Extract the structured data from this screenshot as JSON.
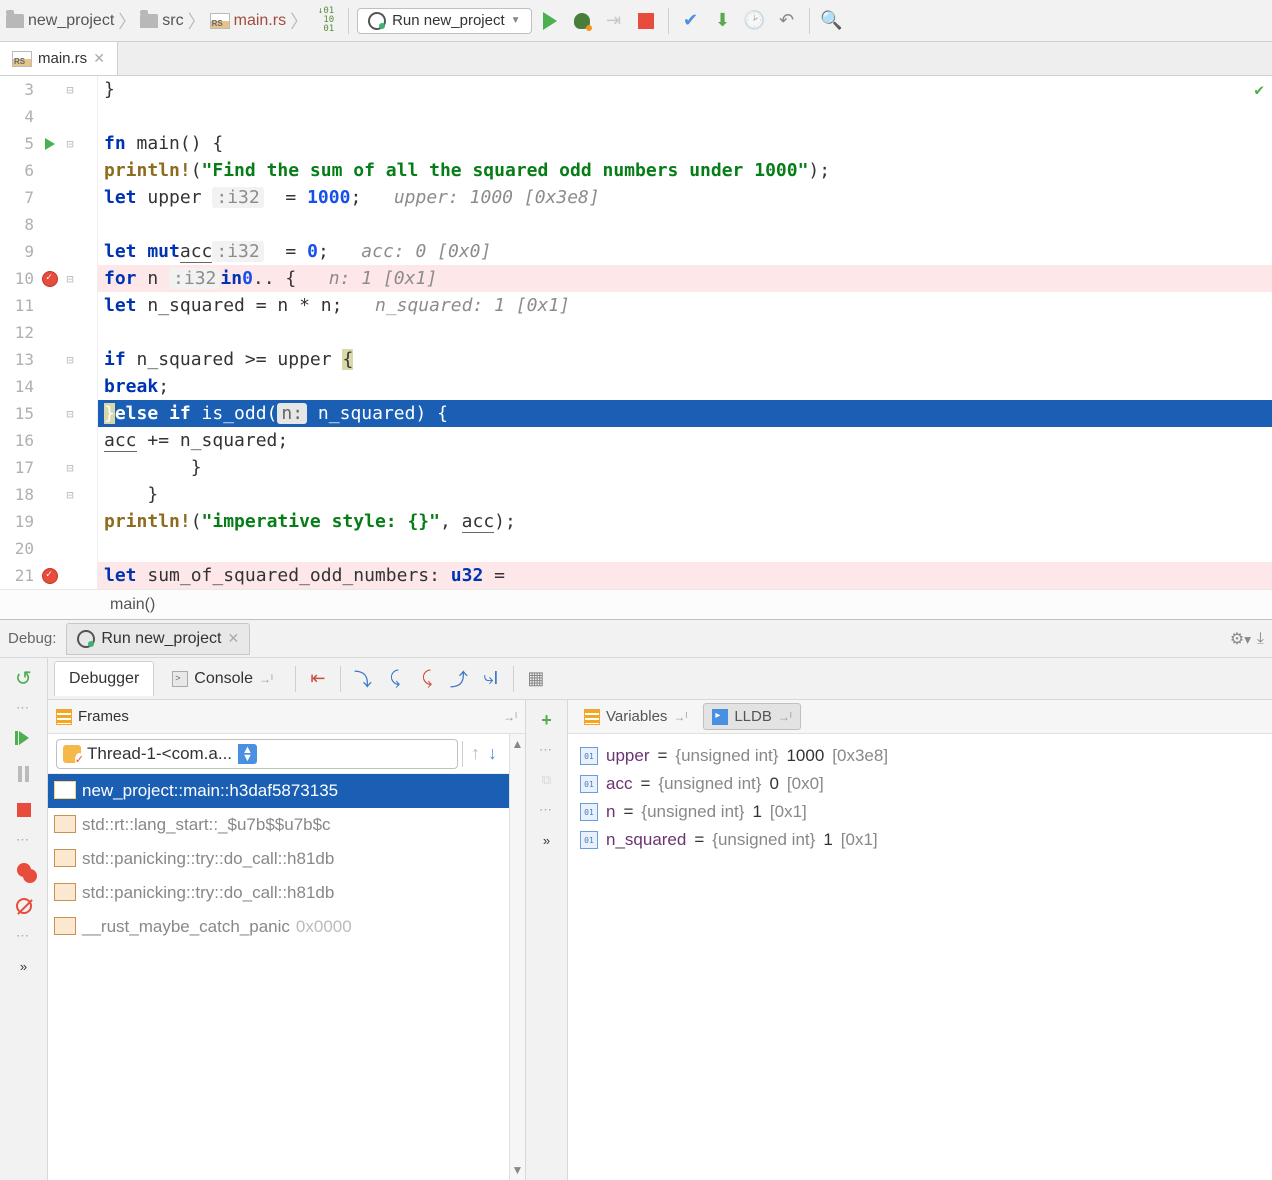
{
  "breadcrumb": {
    "project": "new_project",
    "folder": "src",
    "file": "main.rs"
  },
  "run_config": {
    "label": "Run new_project"
  },
  "editor_tab": {
    "label": "main.rs"
  },
  "editor": {
    "lines": [
      {
        "no": 3,
        "gutter": "",
        "code_html": "}"
      },
      {
        "no": 4,
        "gutter": "",
        "code_html": ""
      },
      {
        "no": 5,
        "gutter": "run",
        "code_html": "<span class='kw'>fn</span> main() {"
      },
      {
        "no": 6,
        "gutter": "",
        "code_html": "    <span class='mac'>println!</span>(<span class='str'>\"Find the sum of all the squared odd numbers under 1000\"</span>);"
      },
      {
        "no": 7,
        "gutter": "",
        "code_html": "    <span class='kw'>let</span> upper <span class='ty'>:i32</span>  = <span class='num'>1000</span>;   <span class='hint-inline'>upper: 1000 [0x3e8]</span>"
      },
      {
        "no": 8,
        "gutter": "",
        "code_html": ""
      },
      {
        "no": 9,
        "gutter": "",
        "code_html": "    <span class='kw'>let mut</span> <span class='under'>acc</span> <span class='ty'>:i32</span>  = <span class='num'>0</span>;   <span class='hint-inline'>acc: 0 [0x0]</span>"
      },
      {
        "no": 10,
        "gutter": "bp",
        "hl": "stop",
        "code_html": "    <span class='kw'>for</span> n <span class='ty'>:i32</span>  <span class='kw'>in</span> <span class='num'>0</span>.. {   <span class='hint-inline'>n: 1 [0x1]</span>"
      },
      {
        "no": 11,
        "gutter": "",
        "code_html": "        <span class='kw'>let</span> n_squared = n * n;   <span class='hint-inline'>n_squared: 1 [0x1]</span>"
      },
      {
        "no": 12,
        "gutter": "",
        "code_html": ""
      },
      {
        "no": 13,
        "gutter": "",
        "code_html": "        <span class='kw'>if</span> n_squared >= upper <span class='brace-hl'>{</span>"
      },
      {
        "no": 14,
        "gutter": "",
        "code_html": "            <span class='kw'>break</span>;"
      },
      {
        "no": 15,
        "gutter": "",
        "hl": "exec",
        "code_html": "        <span class='brace-hl'>}</span> <span class='kw'>else if</span> is_odd(<span class='param-hint'>n:</span> n_squared) {"
      },
      {
        "no": 16,
        "gutter": "",
        "code_html": "            <span class='under'>acc</span> += n_squared;"
      },
      {
        "no": 17,
        "gutter": "",
        "code_html": "        }"
      },
      {
        "no": 18,
        "gutter": "",
        "code_html": "    }"
      },
      {
        "no": 19,
        "gutter": "",
        "code_html": "    <span class='mac'>println!</span>(<span class='str'>\"imperative style: {}\"</span>, <span class='under'>acc</span>);"
      },
      {
        "no": 20,
        "gutter": "",
        "code_html": ""
      },
      {
        "no": 21,
        "gutter": "bp",
        "hl": "stop",
        "code_html": "    <span class='kw'>let</span> sum_of_squared_odd_numbers: <span class='kw'>u32</span> ="
      }
    ],
    "bottom_crumb": "main()"
  },
  "debug": {
    "label": "Debug:",
    "tab": "Run new_project",
    "sub_tabs": {
      "debugger": "Debugger",
      "console": "Console"
    },
    "frames_label": "Frames",
    "thread": "Thread-1-<com.a...",
    "frames": [
      {
        "text": "new_project::main::h3daf5873135",
        "selected": true
      },
      {
        "text": "std::rt::lang_start::_$u7b$$u7b$c"
      },
      {
        "text": "std::panicking::try::do_call::h81db"
      },
      {
        "text": "std::panicking::try::do_call::h81db"
      },
      {
        "text": "__rust_maybe_catch_panic",
        "addr": "0x0000"
      }
    ],
    "vars_label": "Variables",
    "lldb_label": "LLDB",
    "variables": [
      {
        "name": "upper",
        "type": "{unsigned int}",
        "val": "1000",
        "hex": "[0x3e8]"
      },
      {
        "name": "acc",
        "type": "{unsigned int}",
        "val": "0",
        "hex": "[0x0]"
      },
      {
        "name": "n",
        "type": "{unsigned int}",
        "val": "1",
        "hex": "[0x1]"
      },
      {
        "name": "n_squared",
        "type": "{unsigned int}",
        "val": "1",
        "hex": "[0x1]"
      }
    ]
  }
}
